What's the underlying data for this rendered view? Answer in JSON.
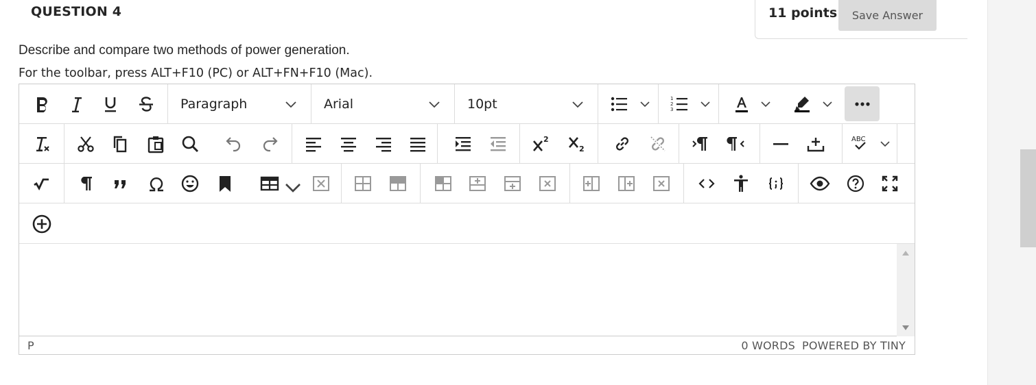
{
  "question": {
    "title": "QUESTION 4",
    "points": "11 points",
    "save_label": "Save Answer",
    "prompt": "Describe and compare two methods of power generation.",
    "toolbar_hint": "For the toolbar, press ALT+F10 (PC) or ALT+FN+F10 (Mac)."
  },
  "toolbar": {
    "block_format": "Paragraph",
    "font_family": "Arial",
    "font_size": "10pt",
    "text_color": "#000000",
    "highlight_color": "#000000",
    "spellcheck_label": "ABC"
  },
  "statusbar": {
    "path": "P",
    "word_count": "0 WORDS",
    "powered_by": "POWERED BY TINY"
  }
}
